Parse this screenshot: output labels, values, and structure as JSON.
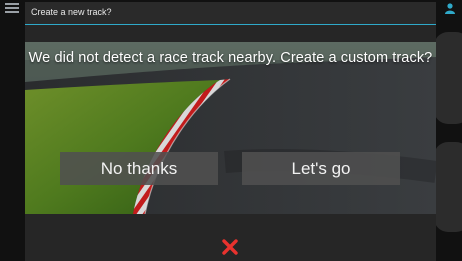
{
  "app": {
    "menu_icon": "hamburger-menu-icon",
    "user_icon": "user-icon"
  },
  "dialog": {
    "title": "Create a new track?",
    "message": "We did not detect a race track nearby. Create a custom track?",
    "buttons": {
      "decline_label": "No thanks",
      "accept_label": "Let's go"
    },
    "close_icon": "close-icon"
  },
  "colors": {
    "accent": "#2fa9c9",
    "close": "#e8322e",
    "button_bg": "#505050"
  }
}
